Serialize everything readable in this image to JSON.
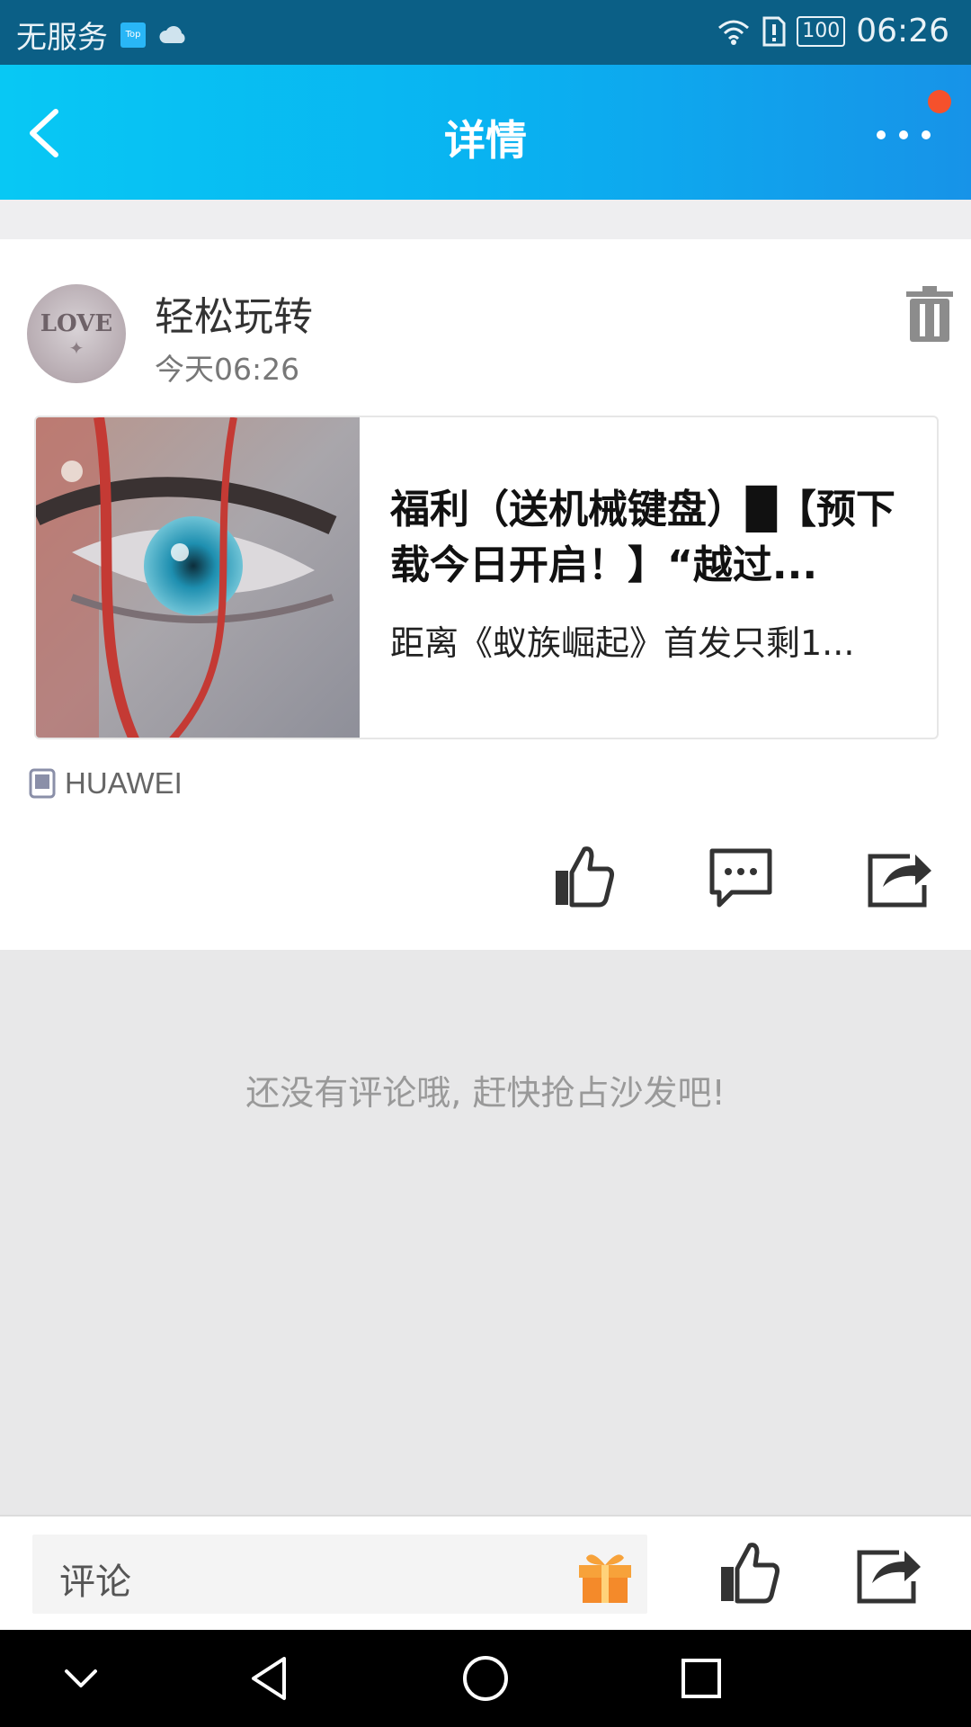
{
  "status_bar": {
    "carrier": "无服务",
    "app_badge": "Top",
    "battery": "100",
    "time": "06:26"
  },
  "header": {
    "title": "详情",
    "has_notification": true
  },
  "post": {
    "username": "轻松玩转",
    "time": "今天06:26",
    "avatar_text": "LOVE",
    "link_card": {
      "title": "福利（送机械键盘）█【预下载今日开启！】“越过...",
      "description": "距离《蚁族崛起》首发只剩1..."
    },
    "device": "HUAWEI"
  },
  "comments": {
    "empty_message": "还没有评论哦, 赶快抢占沙发吧!"
  },
  "bottom_bar": {
    "comment_placeholder": "评论"
  },
  "icons": {
    "back": "chevron-left-icon",
    "more": "more-dots-icon",
    "delete": "trash-icon",
    "device": "phone-icon",
    "like": "thumbs-up-icon",
    "comment": "comment-bubble-icon",
    "share": "share-icon",
    "gift": "gift-icon"
  },
  "colors": {
    "header_start": "#08c8f4",
    "header_end": "#1793e8",
    "notification_dot": "#f5512c",
    "status_bar": "#0b5f86"
  }
}
